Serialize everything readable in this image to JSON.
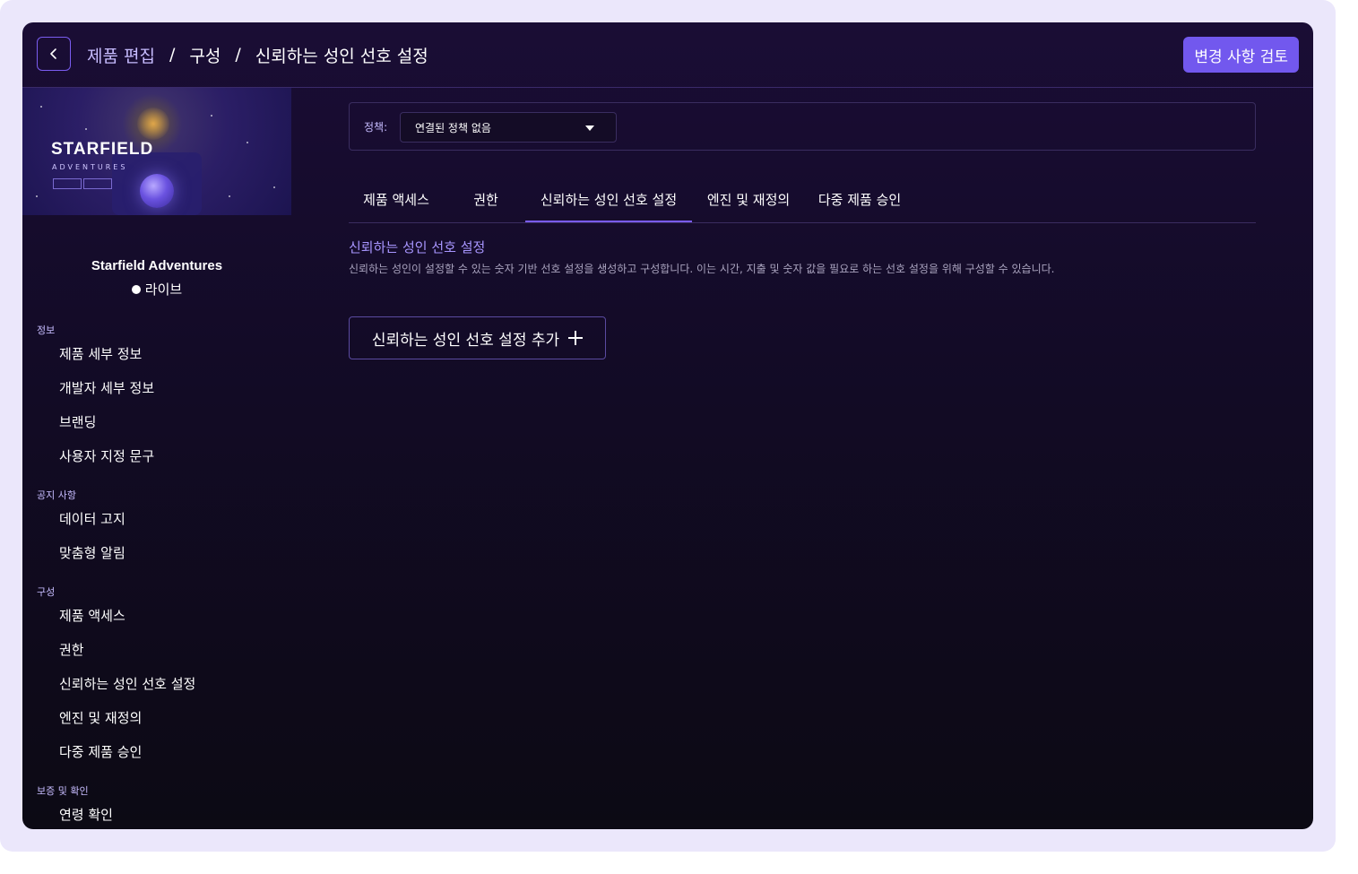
{
  "header": {
    "breadcrumb": [
      "제품 편집",
      "구성",
      "신뢰하는 성인 선호 설정"
    ],
    "separator": "/",
    "review_button": "변경 사항 검토"
  },
  "sidebar": {
    "banner": {
      "title": "STARFIELD",
      "subtitle": "ADVENTURES"
    },
    "product_name": "Starfield Adventures",
    "status": "라이브",
    "sections": [
      {
        "label": "정보",
        "items": [
          "제품 세부 정보",
          "개발자 세부 정보",
          "브랜딩",
          "사용자 지정 문구"
        ]
      },
      {
        "label": "공지 사항",
        "items": [
          "데이터 고지",
          "맞춤형 알림"
        ]
      },
      {
        "label": "구성",
        "items": [
          "제품 액세스",
          "권한",
          "신뢰하는 성인 선호 설정",
          "엔진 및 재정의",
          "다중 제품 승인"
        ]
      },
      {
        "label": "보증 및 확인",
        "items": [
          "연령 확인"
        ]
      }
    ]
  },
  "main": {
    "policy": {
      "label": "정책:",
      "selected": "연결된 정책 없음"
    },
    "tabs": [
      "제품 액세스",
      "권한",
      "신뢰하는 성인 선호 설정",
      "엔진 및 재정의",
      "다중 제품 승인"
    ],
    "active_tab": "신뢰하는 성인 선호 설정",
    "section_title": "신뢰하는 성인 선호 설정",
    "section_description": "신뢰하는 성인이 설정할 수 있는 숫자 기반 선호 설정을 생성하고 구성합니다. 이는 시간, 지출 및 숫자 값을 필요로 하는 선호 설정을 위해 구성할 수 있습니다.",
    "add_button": "신뢰하는 성인 선호 설정 추가"
  },
  "colors": {
    "accent": "#7258ee",
    "background": "#130b27",
    "frame": "#ebe7fb"
  }
}
